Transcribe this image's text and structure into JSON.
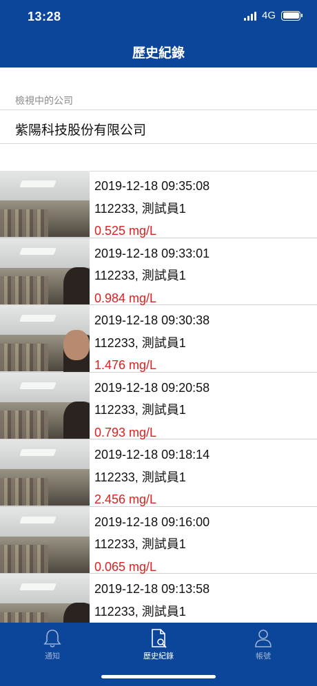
{
  "status_bar": {
    "time": "13:28",
    "network": "4G"
  },
  "nav": {
    "title": "歷史紀錄"
  },
  "company": {
    "label": "檢視中的公司",
    "name": "紫陽科技股份有限公司"
  },
  "records": [
    {
      "datetime": "2019-12-18 09:35:08",
      "user": "112233, 測試員1",
      "value": "0.525 mg/L"
    },
    {
      "datetime": "2019-12-18 09:33:01",
      "user": "112233, 測試員1",
      "value": "0.984 mg/L"
    },
    {
      "datetime": "2019-12-18 09:30:38",
      "user": "112233, 測試員1",
      "value": "1.476 mg/L"
    },
    {
      "datetime": "2019-12-18 09:20:58",
      "user": "112233, 測試員1",
      "value": "0.793 mg/L"
    },
    {
      "datetime": "2019-12-18 09:18:14",
      "user": "112233, 測試員1",
      "value": "2.456 mg/L"
    },
    {
      "datetime": "2019-12-18 09:16:00",
      "user": "112233, 測試員1",
      "value": "0.065 mg/L"
    },
    {
      "datetime": "2019-12-18 09:13:58",
      "user": "112233, 測試員1",
      "value": ""
    }
  ],
  "tabs": [
    {
      "label": "通知",
      "icon": "bell-icon",
      "active": false
    },
    {
      "label": "歷史紀錄",
      "icon": "document-search-icon",
      "active": true
    },
    {
      "label": "帳號",
      "icon": "person-icon",
      "active": false
    }
  ],
  "colors": {
    "primary": "#0b469a",
    "value_text": "#e02020"
  }
}
